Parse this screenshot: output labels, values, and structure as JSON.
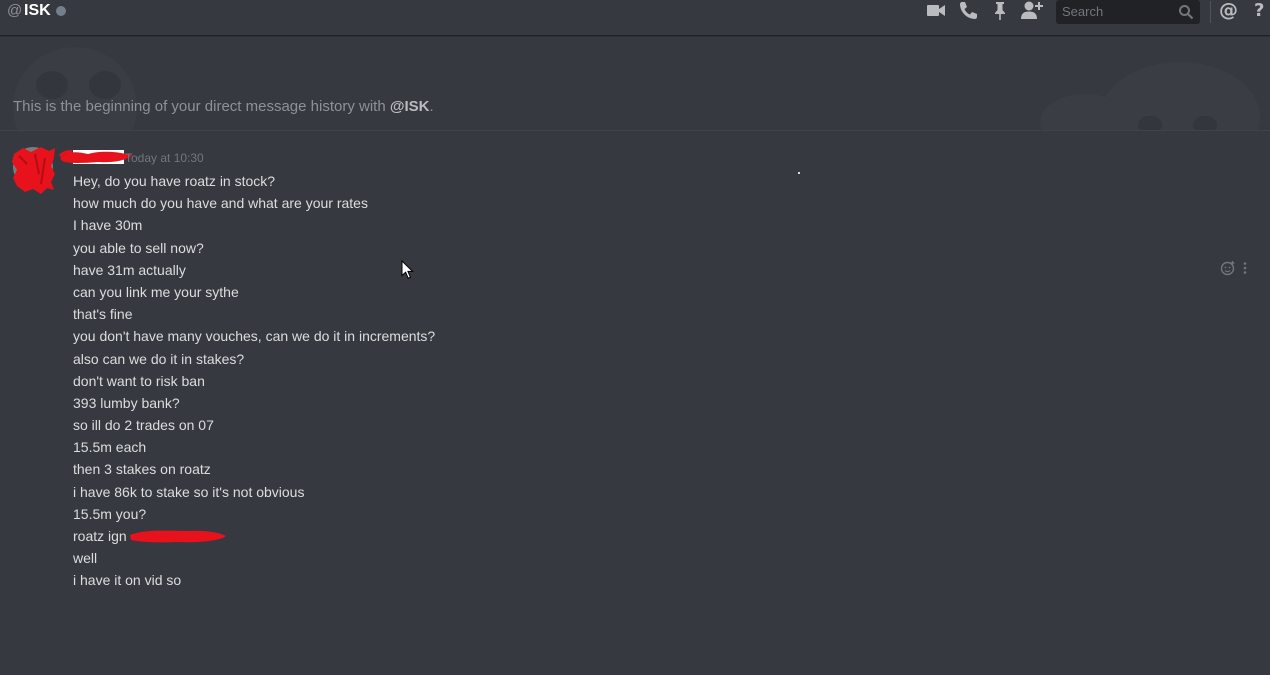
{
  "header": {
    "at_symbol": "@",
    "name": "ISK",
    "status": "offline",
    "icons": [
      "video-call-icon",
      "voice-call-icon",
      "pin-icon",
      "add-friend-icon",
      "search-icon",
      "mention-icon",
      "help-icon"
    ],
    "search_placeholder": "Search",
    "mention_label": "@",
    "help_label": "?"
  },
  "welcome": {
    "text": "This is the beginning of your direct message history with ",
    "mention": "@ISK",
    "period": "."
  },
  "message_group": {
    "username": "██████",
    "timestamp": "Today at 10:30",
    "messages": [
      "Hey, do you have roatz in stock?",
      "how much do you have and what are your rates",
      "I have 30m",
      "you able to sell now?",
      "have 31m actually",
      "can you link me your sythe",
      "that's fine",
      "you don't have many vouches, can we do it in increments?",
      "also can we do it in stakes?",
      "don't want to risk ban",
      "393 lumby bank?",
      "so ill do 2 trades on 07",
      "15.5m each",
      "then 3 stakes on roatz",
      "i have 86k to stake so it's not obvious",
      "15.5m you?",
      "roatz ign ",
      "well",
      "i have it on vid so"
    ]
  },
  "colors": {
    "background": "#36393f",
    "text": "#dcddde",
    "muted": "#8e9297",
    "redaction": "#e8121d"
  }
}
